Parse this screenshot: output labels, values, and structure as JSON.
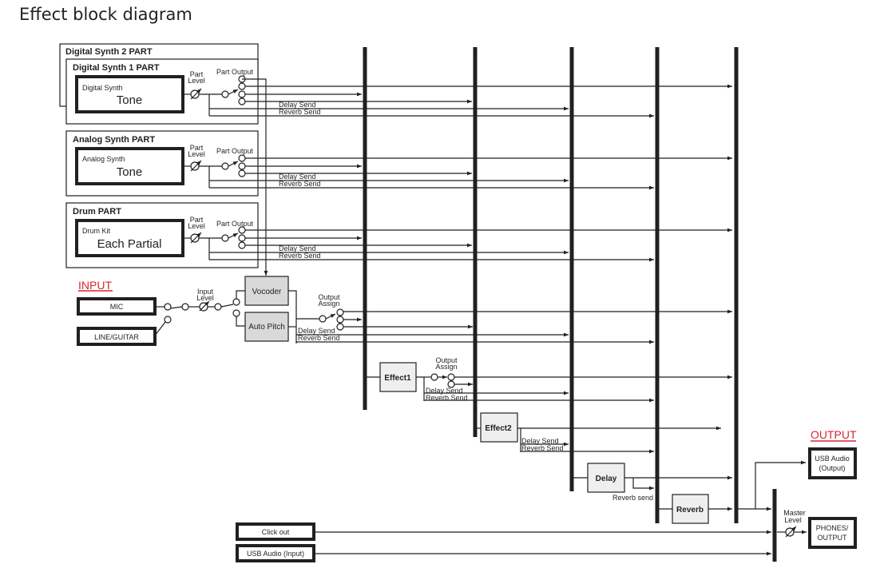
{
  "title": "Effect block diagram",
  "parts": [
    {
      "name": "Digital Synth 2 PART"
    },
    {
      "name": "Digital Synth 1 PART",
      "source_small": "Digital Synth",
      "source_big": "Tone",
      "level_label": [
        "Part",
        "Level"
      ],
      "output_label": "Part Output",
      "delay_send": "Delay Send",
      "reverb_send": "Reverb Send"
    },
    {
      "name": "Analog Synth PART",
      "source_small": "Analog Synth",
      "source_big": "Tone",
      "level_label": [
        "Part",
        "Level"
      ],
      "output_label": "Part Output",
      "delay_send": "Delay Send",
      "reverb_send": "Reverb Send"
    },
    {
      "name": "Drum  PART",
      "source_small": "Drum Kit",
      "source_big": "Each Partial",
      "level_label": [
        "Part",
        "Level"
      ],
      "output_label": "Part Output",
      "delay_send": "Delay Send",
      "reverb_send": "Reverb Send"
    }
  ],
  "input": {
    "heading": "INPUT",
    "sources": [
      "MIC",
      "LINE/GUITAR"
    ],
    "level_label": [
      "Input",
      "Level"
    ],
    "processors": [
      "Vocoder",
      "Auto Pitch"
    ],
    "output_assign": [
      "Output",
      "Assign"
    ],
    "delay_send": "Delay Send",
    "reverb_send": "Reverb Send"
  },
  "effects": {
    "effect1": {
      "label": "Effect1",
      "output_assign": [
        "Output",
        "Assign"
      ],
      "delay_send": "Delay Send",
      "reverb_send": "Reverb Send"
    },
    "effect2": {
      "label": "Effect2",
      "delay_send": "Delay Send",
      "reverb_send": "Reverb Send"
    },
    "delay": {
      "label": "Delay",
      "reverb_send": "Reverb send"
    },
    "reverb": {
      "label": "Reverb"
    }
  },
  "extra_inputs": [
    "Click out",
    "USB Audio (Input)"
  ],
  "output": {
    "heading": "OUTPUT",
    "usb": [
      "USB Audio",
      "(Output)"
    ],
    "master_label": [
      "Master",
      "Level"
    ],
    "phones": [
      "PHONES/",
      "OUTPUT"
    ]
  },
  "colors": {
    "accent_red": "#d7262e",
    "line": "#231f20",
    "processor_fill": "#d9d9d9",
    "effect_fill": "#efefef"
  }
}
